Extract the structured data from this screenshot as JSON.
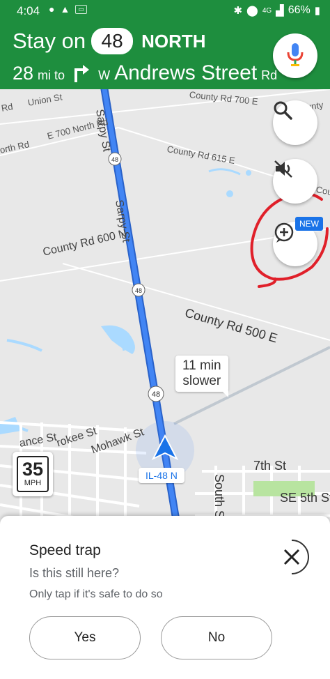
{
  "status_bar": {
    "time": "4:04",
    "pay_label": "Samsung Pay",
    "signal": "4G",
    "battery": "66%"
  },
  "navigation": {
    "instruction_prefix": "Stay on",
    "route_number": "48",
    "direction": "NORTH",
    "distance_value": "28",
    "distance_unit": "mi to",
    "turn_icon": "turn-right-arrow-icon",
    "street_prefix": "W",
    "street_name": "Andrews Street",
    "street_suffix": "Rd"
  },
  "map": {
    "labels": {
      "union_st": "Union St",
      "rd_left": "Rd",
      "county_rd_700": "County Rd 700 E",
      "e_700_north": "E 700 North Rd",
      "north_rd": "orth Rd",
      "sarpy_st_top": "Sarpy St",
      "county_rd_615": "County Rd 615 E",
      "sarpy_st": "Sarpy St",
      "county_rd_600": "County Rd 600 N",
      "county_rd_500": "County Rd 500 E",
      "prince_st": "ance St",
      "cherokee_st": "rokee St",
      "mohawk_st": "Mohawk St",
      "seventh_st": "7th St",
      "south_st": "South S",
      "se_fifth_st": "SE 5th St",
      "county_right": "unty",
      "cou_right": "Cou"
    },
    "route_markers": [
      "48",
      "48",
      "48"
    ],
    "new_badge": "NEW",
    "traffic_callout_line1": "11 min",
    "traffic_callout_line2": "slower",
    "speed_limit": {
      "value": "35",
      "unit": "MPH"
    },
    "current_road": "IL-48 N",
    "colors": {
      "route": "#4285f4",
      "header": "#1e8e3e",
      "annotation": "#e0202a"
    }
  },
  "sheet": {
    "title": "Speed trap",
    "question": "Is this still here?",
    "hint": "Only tap if it's safe to do so",
    "yes_label": "Yes",
    "no_label": "No"
  }
}
